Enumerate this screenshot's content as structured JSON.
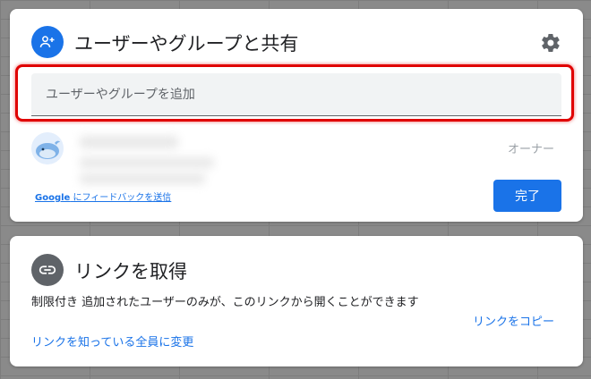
{
  "share": {
    "title": "ユーザーやグループと共有",
    "add_placeholder": "ユーザーやグループを追加",
    "owner_role": "オーナー",
    "feedback_brand": "Google",
    "feedback_text": " にフィードバックを送信",
    "done_label": "完了"
  },
  "link": {
    "title": "リンクを取得",
    "permission_level": "制限付き",
    "permission_desc": "追加されたユーザーのみが、このリンクから開くことができます",
    "change_label": "リンクを知っている全員に変更",
    "copy_label": "リンクをコピー"
  },
  "icons": {
    "share": "person-add-icon",
    "settings": "gear-icon",
    "link": "link-icon",
    "avatar": "whale-avatar"
  },
  "colors": {
    "accent": "#1a73e8",
    "highlight": "#e00000"
  }
}
